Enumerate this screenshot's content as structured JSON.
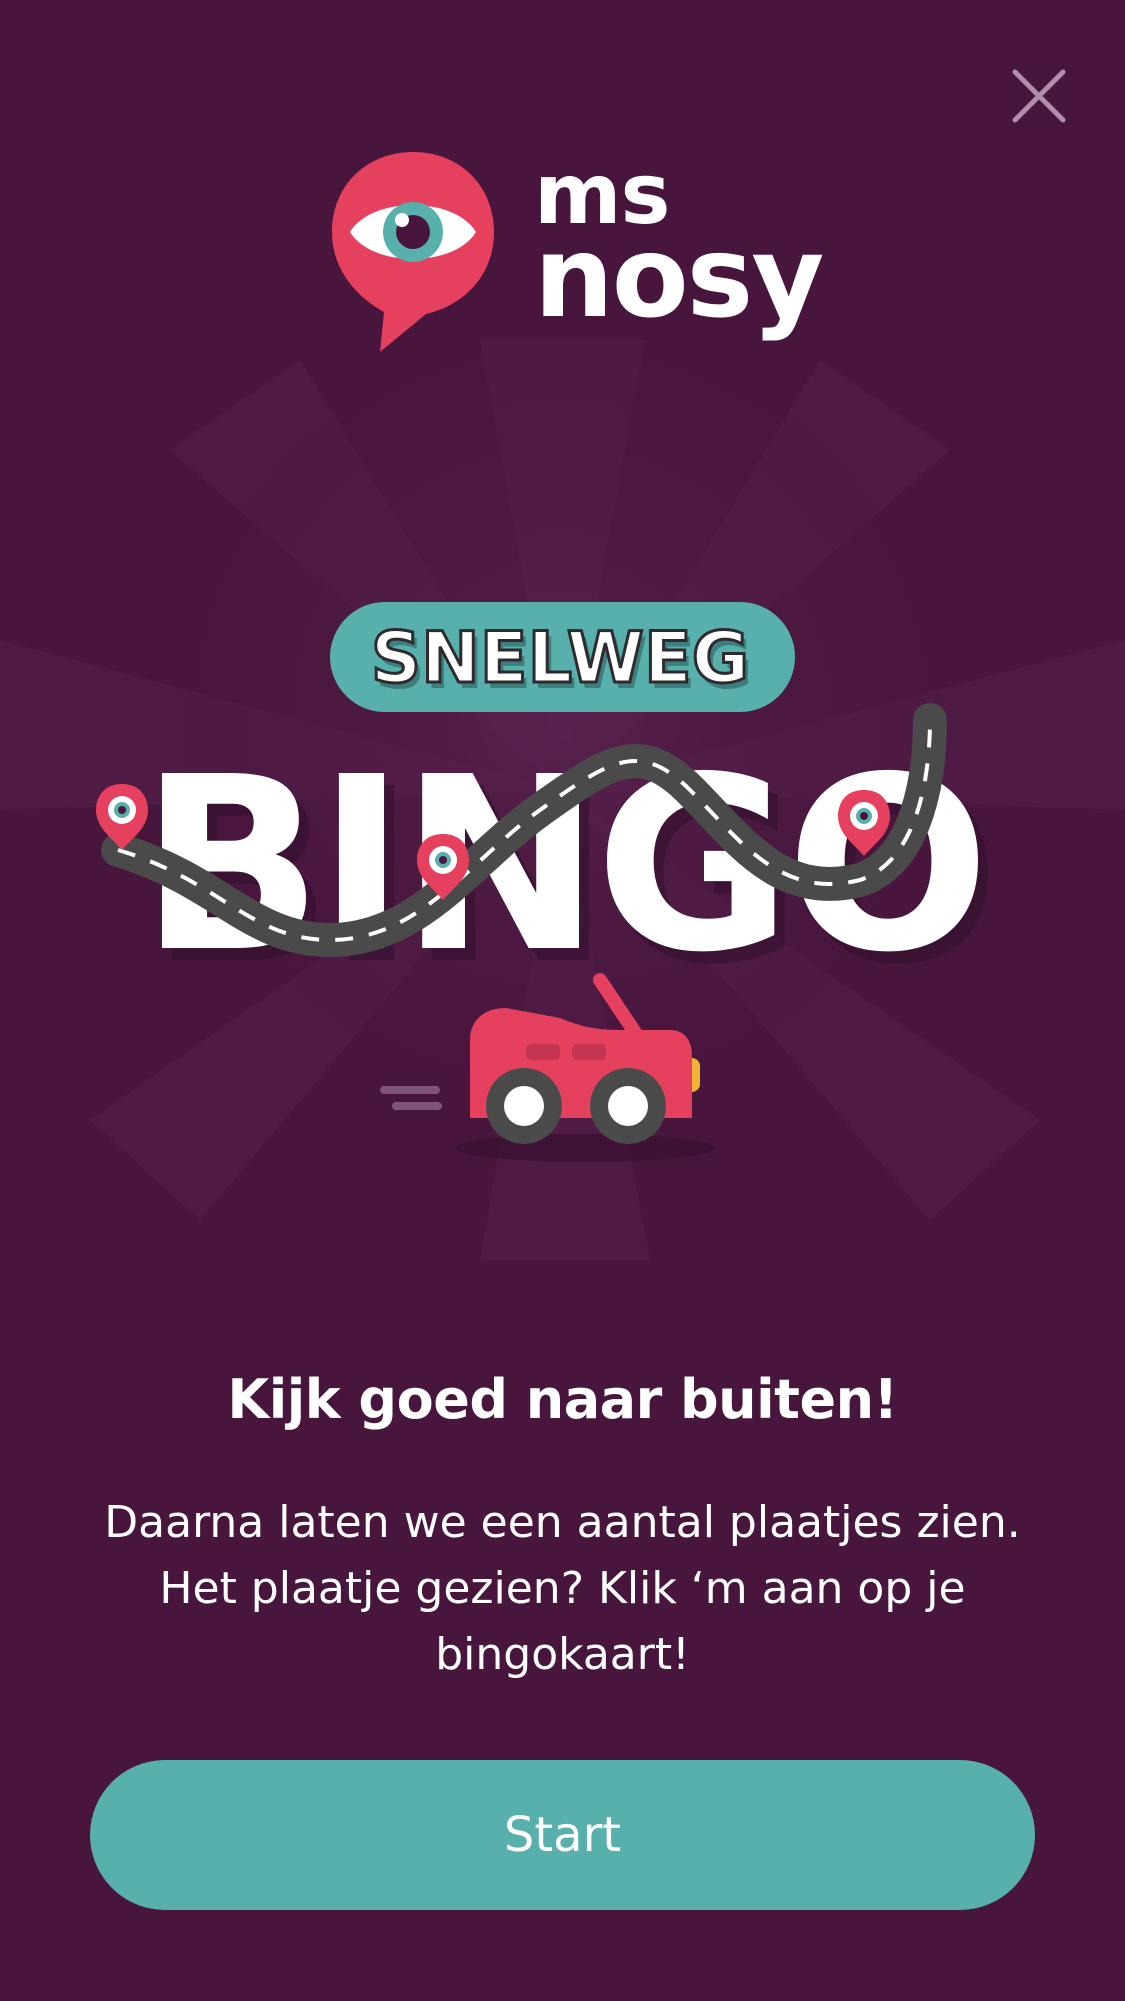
{
  "brand": {
    "line1": "ms",
    "line2": "nosy",
    "icon": "eye-pin-icon"
  },
  "close": {
    "icon": "close-icon"
  },
  "game": {
    "subtitle": "SNELWEG",
    "title": "BINGO"
  },
  "intro": {
    "headline": "Kijk goed naar buiten!",
    "description": "Daarna laten we een aantal plaatjes zien. Het plaatje gezien? Klik ‘m aan op je bingokaart!"
  },
  "actions": {
    "start_label": "Start"
  },
  "colors": {
    "background": "#48163d",
    "brand_red": "#e5405e",
    "teal": "#57b0ac",
    "road": "#4a4a4a",
    "white": "#ffffff"
  }
}
